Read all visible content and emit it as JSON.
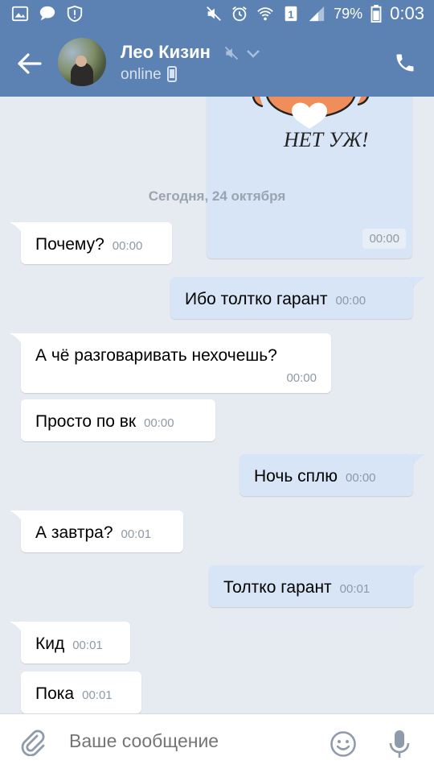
{
  "status_bar": {
    "battery": "79%",
    "time": "0:03",
    "icons": [
      "gallery-icon",
      "chat-bubble-icon",
      "shield-alert-icon",
      "mute-icon",
      "alarm-icon",
      "wifi-icon",
      "sim-1-icon",
      "signal-icon",
      "battery-icon"
    ]
  },
  "header": {
    "contact_name": "Лео Кизин",
    "status": "online",
    "icons": [
      "back-arrow-icon",
      "avatar",
      "muted-icon",
      "chevron-down-icon",
      "mobile-phone-icon",
      "call-icon"
    ]
  },
  "chat": {
    "sticker": {
      "text": "НЕТ УЖ!",
      "time": "00:00",
      "direction": "out"
    },
    "date_divider": "Сегодня, 24 октября",
    "messages": [
      {
        "text": "Почему?",
        "time": "00:00",
        "direction": "in"
      },
      {
        "text": "Ибо толтко гарант",
        "time": "00:00",
        "direction": "out"
      },
      {
        "text": "А чё разговаривать нехочешь?",
        "time": "00:00",
        "direction": "in"
      },
      {
        "text": "Просто по вк",
        "time": "00:00",
        "direction": "in"
      },
      {
        "text": "Ночь сплю",
        "time": "00:00",
        "direction": "out"
      },
      {
        "text": "А завтра?",
        "time": "00:01",
        "direction": "in"
      },
      {
        "text": "Толтко гарант",
        "time": "00:01",
        "direction": "out"
      },
      {
        "text": "Кид",
        "time": "00:01",
        "direction": "in"
      },
      {
        "text": "Пока",
        "time": "00:01",
        "direction": "in"
      }
    ]
  },
  "composer": {
    "placeholder": "Ваше сообщение",
    "value": "",
    "icons": [
      "attach-icon",
      "emoji-icon",
      "microphone-icon"
    ]
  },
  "colors": {
    "header_bg": "#5c82b4",
    "chat_bg": "#e6ebf1",
    "incoming_bubble": "#ffffff",
    "outgoing_bubble": "#d7e5f6",
    "time_text": "#8e99a5"
  }
}
